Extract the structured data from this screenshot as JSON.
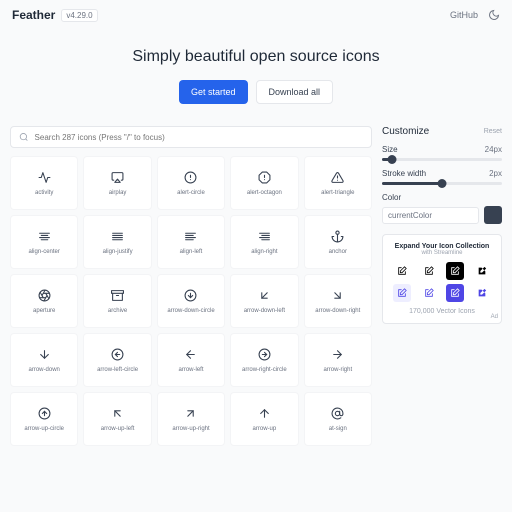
{
  "brand": "Feather",
  "version": "v4.29.0",
  "github": "GitHub",
  "hero": {
    "title": "Simply beautiful open source icons",
    "get_started": "Get started",
    "download_all": "Download all"
  },
  "search": {
    "placeholder": "Search 287 icons (Press \"/\" to focus)"
  },
  "icons": [
    "activity",
    "airplay",
    "alert-circle",
    "alert-octagon",
    "alert-triangle",
    "align-center",
    "align-justify",
    "align-left",
    "align-right",
    "anchor",
    "aperture",
    "archive",
    "arrow-down-circle",
    "arrow-down-left",
    "arrow-down-right",
    "arrow-down",
    "arrow-left-circle",
    "arrow-left",
    "arrow-right-circle",
    "arrow-right",
    "arrow-up-circle",
    "arrow-up-left",
    "arrow-up-right",
    "arrow-up",
    "at-sign"
  ],
  "customize": {
    "title": "Customize",
    "reset": "Reset",
    "size_label": "Size",
    "size_value": "24px",
    "stroke_label": "Stroke width",
    "stroke_value": "2px",
    "color_label": "Color",
    "color_value": "currentColor"
  },
  "promo": {
    "title": "Expand Your Icon Collection",
    "subtitle": "with Streamline",
    "footer": "170,000 Vector Icons",
    "ad": "Ad"
  }
}
